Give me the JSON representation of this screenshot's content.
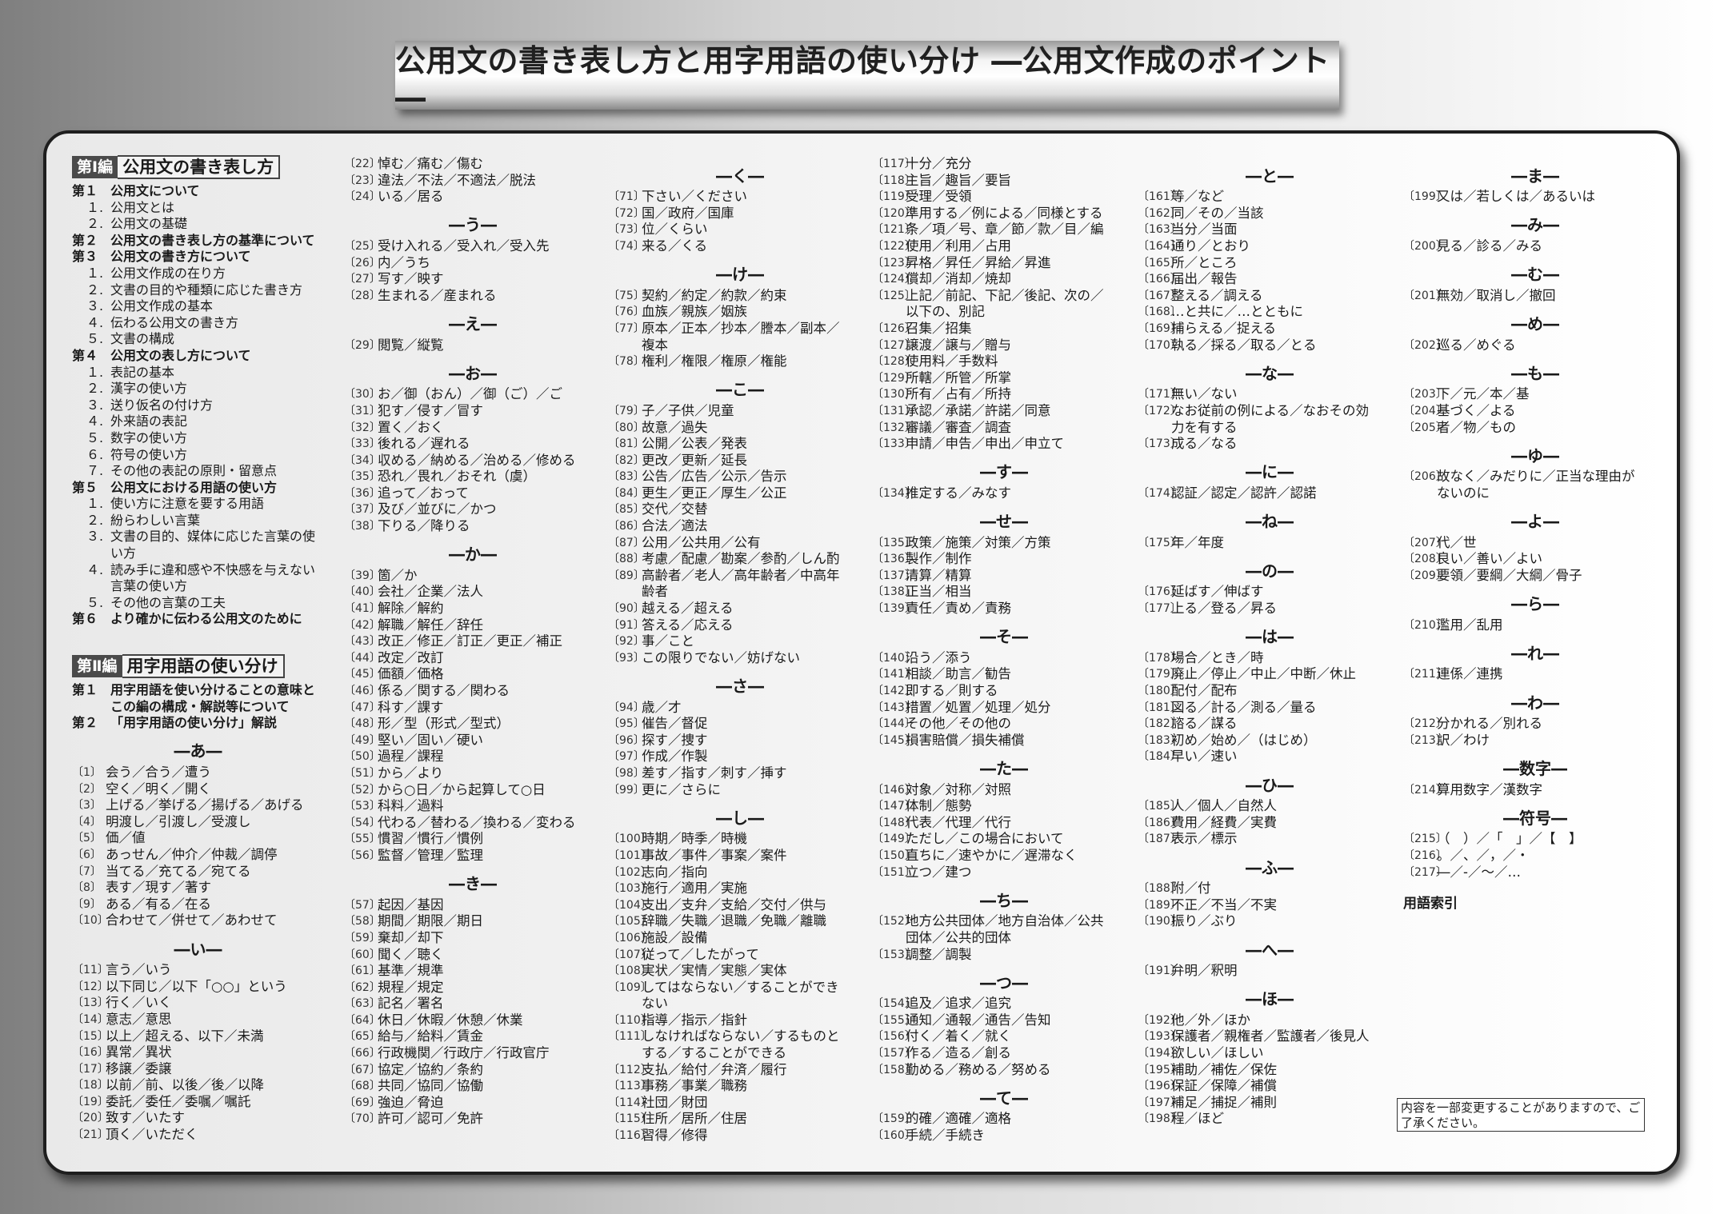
{
  "title": "公用文の書き表し方と用字用語の使い分け ―公用文作成のポイント―",
  "part1": {
    "tag": "第Ⅰ編",
    "heading": "公用文の書き表し方",
    "lines": [
      {
        "k": "ch",
        "lbl": "第１",
        "t": "公用文について"
      },
      {
        "k": "sub",
        "n": "１.",
        "t": "公用文とは"
      },
      {
        "k": "sub",
        "n": "２.",
        "t": "公用文の基礎"
      },
      {
        "k": "ch",
        "lbl": "第２",
        "t": "公用文の書き表し方の基準について"
      },
      {
        "k": "ch",
        "lbl": "第３",
        "t": "公用文の書き方について"
      },
      {
        "k": "sub",
        "n": "１.",
        "t": "公用文作成の在り方"
      },
      {
        "k": "sub",
        "n": "２.",
        "t": "文書の目的や種類に応じた書き方"
      },
      {
        "k": "sub",
        "n": "３.",
        "t": "公用文作成の基本"
      },
      {
        "k": "sub",
        "n": "４.",
        "t": "伝わる公用文の書き方"
      },
      {
        "k": "sub",
        "n": "５.",
        "t": "文書の構成"
      },
      {
        "k": "ch",
        "lbl": "第４",
        "t": "公用文の表し方について"
      },
      {
        "k": "sub",
        "n": "１.",
        "t": "表記の基本"
      },
      {
        "k": "sub",
        "n": "２.",
        "t": "漢字の使い方"
      },
      {
        "k": "sub",
        "n": "３.",
        "t": "送り仮名の付け方"
      },
      {
        "k": "sub",
        "n": "４.",
        "t": "外来語の表記"
      },
      {
        "k": "sub",
        "n": "５.",
        "t": "数字の使い方"
      },
      {
        "k": "sub",
        "n": "６.",
        "t": "符号の使い方"
      },
      {
        "k": "sub",
        "n": "７.",
        "t": "その他の表記の原則・留意点"
      },
      {
        "k": "ch",
        "lbl": "第５",
        "t": "公用文における用語の使い方"
      },
      {
        "k": "sub",
        "n": "１.",
        "t": "使い方に注意を要する用語"
      },
      {
        "k": "sub",
        "n": "２.",
        "t": "紛らわしい言葉"
      },
      {
        "k": "sub",
        "n": "３.",
        "t": "文書の目的、媒体に応じた言葉の使"
      },
      {
        "k": "subc",
        "n": "",
        "t": "い方"
      },
      {
        "k": "sub",
        "n": "４.",
        "t": "読み手に違和感や不快感を与えない"
      },
      {
        "k": "subc",
        "n": "",
        "t": "言葉の使い方"
      },
      {
        "k": "sub",
        "n": "５.",
        "t": "その他の言葉の工夫"
      },
      {
        "k": "ch",
        "lbl": "第６",
        "t": "より確かに伝わる公用文のために"
      }
    ]
  },
  "part2": {
    "tag": "第Ⅱ編",
    "heading": "用字用語の使い分け",
    "lines": [
      {
        "k": "ch",
        "lbl": "第１",
        "t": "用字用語を使い分けることの意味と"
      },
      {
        "k": "chc",
        "lbl": "",
        "t": "この編の構成・解説等について"
      },
      {
        "k": "ch",
        "lbl": "第２",
        "t": "「用字用語の使い分け」解説"
      }
    ]
  },
  "col1_entries": [
    {
      "h": "―あ―"
    },
    {
      "n": "〔1〕",
      "t": "会う／合う／遭う"
    },
    {
      "n": "〔2〕",
      "t": "空く／明く／開く"
    },
    {
      "n": "〔3〕",
      "t": "上げる／挙げる／揚げる／あげる"
    },
    {
      "n": "〔4〕",
      "t": "明渡し／引渡し／受渡し"
    },
    {
      "n": "〔5〕",
      "t": "価／値"
    },
    {
      "n": "〔6〕",
      "t": "あっせん／仲介／仲裁／調停"
    },
    {
      "n": "〔7〕",
      "t": "当てる／充てる／宛てる"
    },
    {
      "n": "〔8〕",
      "t": "表す／現す／著す"
    },
    {
      "n": "〔9〕",
      "t": "ある／有る／在る"
    },
    {
      "n": "〔10〕",
      "t": "合わせて／併せて／あわせて"
    },
    {
      "h": "―い―"
    },
    {
      "n": "〔11〕",
      "t": "言う／いう"
    },
    {
      "n": "〔12〕",
      "t": "以下同じ／以下「○○」という"
    },
    {
      "n": "〔13〕",
      "t": "行く／いく"
    },
    {
      "n": "〔14〕",
      "t": "意志／意思"
    },
    {
      "n": "〔15〕",
      "t": "以上／超える、以下／未満"
    },
    {
      "n": "〔16〕",
      "t": "異常／異状"
    },
    {
      "n": "〔17〕",
      "t": "移譲／委譲"
    },
    {
      "n": "〔18〕",
      "t": "以前／前、以後／後／以降"
    },
    {
      "n": "〔19〕",
      "t": "委託／委任／委嘱／嘱託"
    },
    {
      "n": "〔20〕",
      "t": "致す／いたす"
    },
    {
      "n": "〔21〕",
      "t": "頂く／いただく"
    }
  ],
  "col2": [
    {
      "n": "〔22〕",
      "t": "悼む／痛む／傷む"
    },
    {
      "n": "〔23〕",
      "t": "違法／不法／不適法／脱法"
    },
    {
      "n": "〔24〕",
      "t": "いる／居る"
    },
    {
      "h": "―う―"
    },
    {
      "n": "〔25〕",
      "t": "受け入れる／受入れ／受入先"
    },
    {
      "n": "〔26〕",
      "t": "内／うち"
    },
    {
      "n": "〔27〕",
      "t": "写す／映す"
    },
    {
      "n": "〔28〕",
      "t": "生まれる／産まれる"
    },
    {
      "h": "―え―"
    },
    {
      "n": "〔29〕",
      "t": "閲覧／縦覧"
    },
    {
      "h": "―お―"
    },
    {
      "n": "〔30〕",
      "t": "お／御（おん）／御（ご）／ご"
    },
    {
      "n": "〔31〕",
      "t": "犯す／侵す／冒す"
    },
    {
      "n": "〔32〕",
      "t": "置く／おく"
    },
    {
      "n": "〔33〕",
      "t": "後れる／遅れる"
    },
    {
      "n": "〔34〕",
      "t": "収める／納める／治める／修める"
    },
    {
      "n": "〔35〕",
      "t": "恐れ／畏れ／おそれ（虞）"
    },
    {
      "n": "〔36〕",
      "t": "追って／おって"
    },
    {
      "n": "〔37〕",
      "t": "及び／並びに／かつ"
    },
    {
      "n": "〔38〕",
      "t": "下りる／降りる"
    },
    {
      "h": "―か―"
    },
    {
      "n": "〔39〕",
      "t": "箇／か"
    },
    {
      "n": "〔40〕",
      "t": "会社／企業／法人"
    },
    {
      "n": "〔41〕",
      "t": "解除／解約"
    },
    {
      "n": "〔42〕",
      "t": "解職／解任／辞任"
    },
    {
      "n": "〔43〕",
      "t": "改正／修正／訂正／更正／補正"
    },
    {
      "n": "〔44〕",
      "t": "改定／改訂"
    },
    {
      "n": "〔45〕",
      "t": "価額／価格"
    },
    {
      "n": "〔46〕",
      "t": "係る／関する／関わる"
    },
    {
      "n": "〔47〕",
      "t": "科す／課す"
    },
    {
      "n": "〔48〕",
      "t": "形／型（形式／型式）"
    },
    {
      "n": "〔49〕",
      "t": "堅い／固い／硬い"
    },
    {
      "n": "〔50〕",
      "t": "過程／課程"
    },
    {
      "n": "〔51〕",
      "t": "から／より"
    },
    {
      "n": "〔52〕",
      "t": "から○日／から起算して○日"
    },
    {
      "n": "〔53〕",
      "t": "科料／過料"
    },
    {
      "n": "〔54〕",
      "t": "代わる／替わる／換わる／変わる"
    },
    {
      "n": "〔55〕",
      "t": "慣習／慣行／慣例"
    },
    {
      "n": "〔56〕",
      "t": "監督／管理／監理"
    },
    {
      "h": "―き―"
    },
    {
      "n": "〔57〕",
      "t": "起因／基因"
    },
    {
      "n": "〔58〕",
      "t": "期間／期限／期日"
    },
    {
      "n": "〔59〕",
      "t": "棄却／却下"
    },
    {
      "n": "〔60〕",
      "t": "聞く／聴く"
    },
    {
      "n": "〔61〕",
      "t": "基準／規準"
    },
    {
      "n": "〔62〕",
      "t": "規程／規定"
    },
    {
      "n": "〔63〕",
      "t": "記名／署名"
    },
    {
      "n": "〔64〕",
      "t": "休日／休暇／休憩／休業"
    },
    {
      "n": "〔65〕",
      "t": "給与／給料／賃金"
    },
    {
      "n": "〔66〕",
      "t": "行政機関／行政庁／行政官庁"
    },
    {
      "n": "〔67〕",
      "t": "協定／協約／条約"
    },
    {
      "n": "〔68〕",
      "t": "共同／協同／協働"
    },
    {
      "n": "〔69〕",
      "t": "強迫／脅迫"
    },
    {
      "n": "〔70〕",
      "t": "許可／認可／免許"
    }
  ],
  "col3": [
    {
      "h": "―く―"
    },
    {
      "n": "〔71〕",
      "t": "下さい／ください"
    },
    {
      "n": "〔72〕",
      "t": "国／政府／国庫"
    },
    {
      "n": "〔73〕",
      "t": "位／くらい"
    },
    {
      "n": "〔74〕",
      "t": "来る／くる"
    },
    {
      "h": "―け―"
    },
    {
      "n": "〔75〕",
      "t": "契約／約定／約款／約束"
    },
    {
      "n": "〔76〕",
      "t": "血族／親族／姻族"
    },
    {
      "n": "〔77〕",
      "t": "原本／正本／抄本／謄本／副本／"
    },
    {
      "n": "",
      "t": "複本"
    },
    {
      "n": "〔78〕",
      "t": "権利／権限／権原／権能"
    },
    {
      "h": "―こ―"
    },
    {
      "n": "〔79〕",
      "t": "子／子供／児童"
    },
    {
      "n": "〔80〕",
      "t": "故意／過失"
    },
    {
      "n": "〔81〕",
      "t": "公開／公表／発表"
    },
    {
      "n": "〔82〕",
      "t": "更改／更新／延長"
    },
    {
      "n": "〔83〕",
      "t": "公告／広告／公示／告示"
    },
    {
      "n": "〔84〕",
      "t": "更生／更正／厚生／公正"
    },
    {
      "n": "〔85〕",
      "t": "交代／交替"
    },
    {
      "n": "〔86〕",
      "t": "合法／適法"
    },
    {
      "n": "〔87〕",
      "t": "公用／公共用／公有"
    },
    {
      "n": "〔88〕",
      "t": "考慮／配慮／勘案／参酌／しん酌"
    },
    {
      "n": "〔89〕",
      "t": "高齢者／老人／高年齢者／中高年"
    },
    {
      "n": "",
      "t": "齢者"
    },
    {
      "n": "〔90〕",
      "t": "越える／超える"
    },
    {
      "n": "〔91〕",
      "t": "答える／応える"
    },
    {
      "n": "〔92〕",
      "t": "事／こと"
    },
    {
      "n": "〔93〕",
      "t": "この限りでない／妨げない"
    },
    {
      "h": "―さ―"
    },
    {
      "n": "〔94〕",
      "t": "歳／才"
    },
    {
      "n": "〔95〕",
      "t": "催告／督促"
    },
    {
      "n": "〔96〕",
      "t": "探す／捜す"
    },
    {
      "n": "〔97〕",
      "t": "作成／作製"
    },
    {
      "n": "〔98〕",
      "t": "差す／指す／刺す／挿す"
    },
    {
      "n": "〔99〕",
      "t": "更に／さらに"
    },
    {
      "h": "―し―"
    },
    {
      "n": "〔100〕",
      "t": "時期／時季／時機"
    },
    {
      "n": "〔101〕",
      "t": "事故／事件／事案／案件"
    },
    {
      "n": "〔102〕",
      "t": "志向／指向"
    },
    {
      "n": "〔103〕",
      "t": "施行／適用／実施"
    },
    {
      "n": "〔104〕",
      "t": "支出／支弁／支給／交付／供与"
    },
    {
      "n": "〔105〕",
      "t": "辞職／失職／退職／免職／離職"
    },
    {
      "n": "〔106〕",
      "t": "施設／設備"
    },
    {
      "n": "〔107〕",
      "t": "従って／したがって"
    },
    {
      "n": "〔108〕",
      "t": "実状／実情／実態／実体"
    },
    {
      "n": "〔109〕",
      "t": "してはならない／することができ"
    },
    {
      "n": "",
      "t": "ない"
    },
    {
      "n": "〔110〕",
      "t": "指導／指示／指針"
    },
    {
      "n": "〔111〕",
      "t": "しなければならない／するものと"
    },
    {
      "n": "",
      "t": "する／することができる"
    },
    {
      "n": "〔112〕",
      "t": "支払／給付／弁済／履行"
    },
    {
      "n": "〔113〕",
      "t": "事務／事業／職務"
    },
    {
      "n": "〔114〕",
      "t": "社団／財団"
    },
    {
      "n": "〔115〕",
      "t": "住所／居所／住居"
    },
    {
      "n": "〔116〕",
      "t": "習得／修得"
    }
  ],
  "col4": [
    {
      "n": "〔117〕",
      "t": "十分／充分"
    },
    {
      "n": "〔118〕",
      "t": "主旨／趣旨／要旨"
    },
    {
      "n": "〔119〕",
      "t": "受理／受領"
    },
    {
      "n": "〔120〕",
      "t": "準用する／例による／同様とする"
    },
    {
      "n": "〔121〕",
      "t": "条／項／号、章／節／款／目／編"
    },
    {
      "n": "〔122〕",
      "t": "使用／利用／占用"
    },
    {
      "n": "〔123〕",
      "t": "昇格／昇任／昇給／昇進"
    },
    {
      "n": "〔124〕",
      "t": "償却／消却／焼却"
    },
    {
      "n": "〔125〕",
      "t": "上記／前記、下記／後記、次の／"
    },
    {
      "n": "",
      "t": "以下の、別記"
    },
    {
      "n": "〔126〕",
      "t": "召集／招集"
    },
    {
      "n": "〔127〕",
      "t": "譲渡／譲与／贈与"
    },
    {
      "n": "〔128〕",
      "t": "使用料／手数料"
    },
    {
      "n": "〔129〕",
      "t": "所轄／所管／所掌"
    },
    {
      "n": "〔130〕",
      "t": "所有／占有／所持"
    },
    {
      "n": "〔131〕",
      "t": "承認／承諾／許諾／同意"
    },
    {
      "n": "〔132〕",
      "t": "審議／審査／調査"
    },
    {
      "n": "〔133〕",
      "t": "申請／申告／申出／申立て"
    },
    {
      "h": "―す―"
    },
    {
      "n": "〔134〕",
      "t": "推定する／みなす"
    },
    {
      "h": "―せ―"
    },
    {
      "n": "〔135〕",
      "t": "政策／施策／対策／方策"
    },
    {
      "n": "〔136〕",
      "t": "製作／制作"
    },
    {
      "n": "〔137〕",
      "t": "清算／精算"
    },
    {
      "n": "〔138〕",
      "t": "正当／相当"
    },
    {
      "n": "〔139〕",
      "t": "責任／責め／責務"
    },
    {
      "h": "―そ―"
    },
    {
      "n": "〔140〕",
      "t": "沿う／添う"
    },
    {
      "n": "〔141〕",
      "t": "相談／助言／勧告"
    },
    {
      "n": "〔142〕",
      "t": "即する／則する"
    },
    {
      "n": "〔143〕",
      "t": "措置／処置／処理／処分"
    },
    {
      "n": "〔144〕",
      "t": "その他／その他の"
    },
    {
      "n": "〔145〕",
      "t": "損害賠償／損失補償"
    },
    {
      "h": "―た―"
    },
    {
      "n": "〔146〕",
      "t": "対象／対称／対照"
    },
    {
      "n": "〔147〕",
      "t": "体制／態勢"
    },
    {
      "n": "〔148〕",
      "t": "代表／代理／代行"
    },
    {
      "n": "〔149〕",
      "t": "ただし／この場合において"
    },
    {
      "n": "〔150〕",
      "t": "直ちに／速やかに／遅滞なく"
    },
    {
      "n": "〔151〕",
      "t": "立つ／建つ"
    },
    {
      "h": "―ち―"
    },
    {
      "n": "〔152〕",
      "t": "地方公共団体／地方自治体／公共"
    },
    {
      "n": "",
      "t": "団体／公共的団体"
    },
    {
      "n": "〔153〕",
      "t": "調整／調製"
    },
    {
      "h": "―つ―"
    },
    {
      "n": "〔154〕",
      "t": "追及／追求／追究"
    },
    {
      "n": "〔155〕",
      "t": "通知／通報／通告／告知"
    },
    {
      "n": "〔156〕",
      "t": "付く／着く／就く"
    },
    {
      "n": "〔157〕",
      "t": "作る／造る／創る"
    },
    {
      "n": "〔158〕",
      "t": "勤める／務める／努める"
    },
    {
      "h": "―て―"
    },
    {
      "n": "〔159〕",
      "t": "的確／適確／適格"
    },
    {
      "n": "〔160〕",
      "t": "手続／手続き"
    }
  ],
  "col5": [
    {
      "h": "―と―"
    },
    {
      "n": "〔161〕",
      "t": "等／など"
    },
    {
      "n": "〔162〕",
      "t": "同／その／当該"
    },
    {
      "n": "〔163〕",
      "t": "当分／当面"
    },
    {
      "n": "〔164〕",
      "t": "通り／とおり"
    },
    {
      "n": "〔165〕",
      "t": "所／ところ"
    },
    {
      "n": "〔166〕",
      "t": "届出／報告"
    },
    {
      "n": "〔167〕",
      "t": "整える／調える"
    },
    {
      "n": "〔168〕",
      "t": "…と共に／…とともに"
    },
    {
      "n": "〔169〕",
      "t": "捕らえる／捉える"
    },
    {
      "n": "〔170〕",
      "t": "執る／採る／取る／とる"
    },
    {
      "h": "―な―"
    },
    {
      "n": "〔171〕",
      "t": "無い／ない"
    },
    {
      "n": "〔172〕",
      "t": "なお従前の例による／なおその効"
    },
    {
      "n": "",
      "t": "力を有する"
    },
    {
      "n": "〔173〕",
      "t": "成る／なる"
    },
    {
      "h": "―に―"
    },
    {
      "n": "〔174〕",
      "t": "認証／認定／認許／認諾"
    },
    {
      "h": "―ね―"
    },
    {
      "n": "〔175〕",
      "t": "年／年度"
    },
    {
      "h": "―の―"
    },
    {
      "n": "〔176〕",
      "t": "延ばす／伸ばす"
    },
    {
      "n": "〔177〕",
      "t": "上る／登る／昇る"
    },
    {
      "h": "―は―"
    },
    {
      "n": "〔178〕",
      "t": "場合／とき／時"
    },
    {
      "n": "〔179〕",
      "t": "廃止／停止／中止／中断／休止"
    },
    {
      "n": "〔180〕",
      "t": "配付／配布"
    },
    {
      "n": "〔181〕",
      "t": "図る／計る／測る／量る"
    },
    {
      "n": "〔182〕",
      "t": "諮る／謀る"
    },
    {
      "n": "〔183〕",
      "t": "初め／始め／（はじめ）"
    },
    {
      "n": "〔184〕",
      "t": "早い／速い"
    },
    {
      "h": "―ひ―"
    },
    {
      "n": "〔185〕",
      "t": "人／個人／自然人"
    },
    {
      "n": "〔186〕",
      "t": "費用／経費／実費"
    },
    {
      "n": "〔187〕",
      "t": "表示／標示"
    },
    {
      "h": "―ふ―"
    },
    {
      "n": "〔188〕",
      "t": "附／付"
    },
    {
      "n": "〔189〕",
      "t": "不正／不当／不実"
    },
    {
      "n": "〔190〕",
      "t": "振り／ぶり"
    },
    {
      "h": "―へ―"
    },
    {
      "n": "〔191〕",
      "t": "弁明／釈明"
    },
    {
      "h": "―ほ―"
    },
    {
      "n": "〔192〕",
      "t": "他／外／ほか"
    },
    {
      "n": "〔193〕",
      "t": "保護者／親権者／監護者／後見人"
    },
    {
      "n": "〔194〕",
      "t": "欲しい／ほしい"
    },
    {
      "n": "〔195〕",
      "t": "補助／補佐／保佐"
    },
    {
      "n": "〔196〕",
      "t": "保証／保障／補償"
    },
    {
      "n": "〔197〕",
      "t": "補足／捕捉／補則"
    },
    {
      "n": "〔198〕",
      "t": "程／ほど"
    }
  ],
  "col6": [
    {
      "h": "―ま―"
    },
    {
      "n": "〔199〕",
      "t": "又は／若しくは／あるいは"
    },
    {
      "h": "―み―"
    },
    {
      "n": "〔200〕",
      "t": "見る／診る／みる"
    },
    {
      "h": "―む―"
    },
    {
      "n": "〔201〕",
      "t": "無効／取消し／撤回"
    },
    {
      "h": "―め―"
    },
    {
      "n": "〔202〕",
      "t": "巡る／めぐる"
    },
    {
      "h": "―も―"
    },
    {
      "n": "〔203〕",
      "t": "下／元／本／基"
    },
    {
      "n": "〔204〕",
      "t": "基づく／よる"
    },
    {
      "n": "〔205〕",
      "t": "者／物／もの"
    },
    {
      "h": "―ゆ―"
    },
    {
      "n": "〔206〕",
      "t": "故なく／みだりに／正当な理由が"
    },
    {
      "n": "",
      "t": "ないのに"
    },
    {
      "h": "―よ―"
    },
    {
      "n": "〔207〕",
      "t": "代／世"
    },
    {
      "n": "〔208〕",
      "t": "良い／善い／よい"
    },
    {
      "n": "〔209〕",
      "t": "要領／要綱／大綱／骨子"
    },
    {
      "h": "―ら―"
    },
    {
      "n": "〔210〕",
      "t": "濫用／乱用"
    },
    {
      "h": "―れ―"
    },
    {
      "n": "〔211〕",
      "t": "連係／連携"
    },
    {
      "h": "―わ―"
    },
    {
      "n": "〔212〕",
      "t": "分かれる／別れる"
    },
    {
      "n": "〔213〕",
      "t": "訳／わけ"
    },
    {
      "h": "―数字―"
    },
    {
      "n": "〔214〕",
      "t": "算用数字／漢数字"
    },
    {
      "h": "―符号―"
    },
    {
      "n": "〔215〕",
      "t": "（　）／「　」／【　】"
    },
    {
      "n": "〔216〕",
      "t": "。／、／，／・"
    },
    {
      "n": "〔217〕",
      "t": "―／-／～／…"
    }
  ],
  "index_label": "用語索引",
  "notice": "内容を一部変更することがありますので、ご了承ください。"
}
